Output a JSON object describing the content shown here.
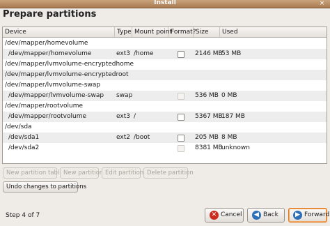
{
  "window": {
    "title": "Install",
    "close_glyph": "×"
  },
  "page": {
    "header": "Prepare partitions"
  },
  "table": {
    "columns": [
      "Device",
      "Type",
      "Mount point",
      "Format?",
      "Size",
      "Used"
    ],
    "rows": [
      {
        "device": "/dev/mapper/homevolume",
        "type": "",
        "mount": "",
        "size": "",
        "used": ""
      },
      {
        "device": "/dev/mapper/homevolume",
        "type": "ext3",
        "mount": "/home",
        "size": "2146 MB",
        "used": "53 MB"
      },
      {
        "device": "/dev/mapper/lvmvolume-encryptedhome",
        "type": "",
        "mount": "",
        "size": "",
        "used": ""
      },
      {
        "device": "/dev/mapper/lvmvolume-encryptedroot",
        "type": "",
        "mount": "",
        "size": "",
        "used": ""
      },
      {
        "device": "/dev/mapper/lvmvolume-swap",
        "type": "",
        "mount": "",
        "size": "",
        "used": ""
      },
      {
        "device": "/dev/mapper/lvmvolume-swap",
        "type": "swap",
        "mount": "",
        "size": "536 MB",
        "used": "0 MB"
      },
      {
        "device": "/dev/mapper/rootvolume",
        "type": "",
        "mount": "",
        "size": "",
        "used": ""
      },
      {
        "device": "/dev/mapper/rootvolume",
        "type": "ext3",
        "mount": "/",
        "size": "5367 MB",
        "used": "187 MB"
      },
      {
        "device": "/dev/sda",
        "type": "",
        "mount": "",
        "size": "",
        "used": ""
      },
      {
        "device": "/dev/sda1",
        "type": "ext2",
        "mount": "/boot",
        "size": "205 MB",
        "used": "8 MB"
      },
      {
        "device": "/dev/sda2",
        "type": "",
        "mount": "",
        "size": "8381 MB",
        "used": "unknown"
      }
    ]
  },
  "actions": {
    "new_table": "New partition table",
    "new_partition": "New partition",
    "edit_partition": "Edit partition",
    "delete_partition": "Delete partition",
    "undo": "Undo changes to partitions"
  },
  "footer": {
    "step": "Step 4 of 7",
    "cancel": "Cancel",
    "back": "Back",
    "forward": "Forward"
  },
  "colors": {
    "cancel_icon": "#cc2a1d",
    "back_icon": "#2f6fb8",
    "forward_icon": "#2f6fb8",
    "focus": "#e07a1f"
  }
}
